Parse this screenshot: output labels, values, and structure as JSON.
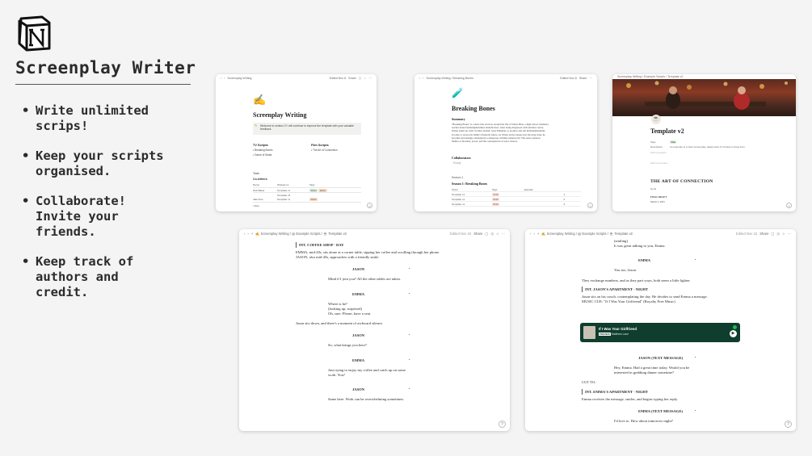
{
  "promo": {
    "title": "Screenplay Writer",
    "features": [
      [
        "Write unlimited",
        "scrips!"
      ],
      [
        "Keep your scripts",
        "organised."
      ],
      [
        "Collaborate!",
        "Invite your",
        "friends."
      ],
      [
        "Keep track of",
        "authors and",
        "credit."
      ]
    ]
  },
  "win1": {
    "crumb": "Screenplay Writing",
    "bar_right": [
      "Edited Nov 8",
      "Share"
    ],
    "title": "Screenplay Writing",
    "callout_lines": [
      "Welcome to version 2! I will continue to improve the template with your valuable",
      "feedback."
    ],
    "tv_heading": "TV Scripts",
    "tv_items": [
      "Breaking Bones",
      "Game of Seats"
    ],
    "film_heading": "Film Scripts",
    "film_items": [
      "The Art of Connection"
    ],
    "todo": "Todo",
    "cowriters": "Co-writers",
    "table_head": [
      "Name",
      "Worked on",
      "Tags"
    ],
    "rows": [
      {
        "name": "Nick Baker",
        "worked": "Template v1",
        "tag1": "Writer",
        "tag2": "Editor"
      },
      {
        "name": "",
        "worked": "Template v2",
        "tag1": "",
        "tag2": ""
      },
      {
        "name": "Jake Doe",
        "worked": "Template v1",
        "tag1": "Writer",
        "tag2": ""
      }
    ],
    "new": "New"
  },
  "win2": {
    "crumb": [
      "Screenplay Writing",
      "Breaking Bones"
    ],
    "bar_right": [
      "Edited Nov 8",
      "Share"
    ],
    "title": "Breaking Bones",
    "summary_h": "Summary",
    "summary_lines": [
      "\"Breaking Bones\" is a show that revolves around the life of Walter Blue, a high school chemistry",
      "teacher turned methamphetamine manufacturer. After being diagnosed with terminal cancer,",
      "Walter teams up with a former student, Jesse Pinkman, to produce and sell methamphetamine",
      "in order to secure his family's financial future. As Walter delves deeper into the drug trade, he",
      "becomes increasingly entangled in a dangerous criminal underworld. The series explores",
      "themes of morality, power, and the consequences of one's choices."
    ],
    "collab_h": "Collaborators",
    "collab_item": "Empty",
    "season_small": "Season 1",
    "season_h": "Season 1: Breaking Bones",
    "season_head": [
      "Script",
      "Tags",
      "Episode"
    ],
    "season_rows": [
      {
        "name": "Template v1",
        "tag": "Draft",
        "ep": "1"
      },
      {
        "name": "Template v1",
        "tag": "Draft",
        "ep": "2"
      },
      {
        "name": "Template v1",
        "tag": "Draft",
        "ep": "3"
      }
    ]
  },
  "win3": {
    "crumb": [
      "Screenplay Writing",
      "Example Scripts",
      "Template v2"
    ],
    "title": "Template v2",
    "props": [
      {
        "k": "Tags",
        "v": "Idea"
      },
      {
        "k": "Description",
        "v": "An example of a short screenplay, adapt parts of it below to draw from."
      },
      {
        "k": "Add a property",
        "v": ""
      }
    ],
    "comment": "Add a comment...",
    "heading": "THE ART OF CONNECTION",
    "by": "by AI",
    "status": "FINAL DRAFT",
    "date": "March 5, 2023"
  },
  "win4": {
    "crumb": [
      "Screenplay Writing",
      "Example Scripts",
      "Template v2"
    ],
    "edited": "Edited Nov 15",
    "share": "Share",
    "lines": [
      {
        "t": "slug",
        "text": "INT. COFFEE SHOP - DAY"
      },
      {
        "t": "action",
        "text": "EMMA, mid-20s, sits alone at a corner table, sipping her coffee and scrolling through her phone."
      },
      {
        "t": "action",
        "text": "JASON, also mid-20s, approaches with a friendly smile."
      },
      {
        "t": "cue",
        "text": "JASON"
      },
      {
        "t": "dlg",
        "text": "Mind if I join you? All the other tables are taken."
      },
      {
        "t": "cue",
        "text": "EMMA"
      },
      {
        "t": "dlg",
        "text": "Where is he?"
      },
      {
        "t": "dlg",
        "text": "(looking up, surprised)"
      },
      {
        "t": "dlg",
        "text": "Oh, sure. Please, have a seat."
      },
      {
        "t": "action",
        "text": "Jason sits down, and there's a moment of awkward silence."
      },
      {
        "t": "cue",
        "text": "JASON"
      },
      {
        "t": "dlg",
        "text": "So, what brings you here?"
      },
      {
        "t": "cue",
        "text": "EMMA"
      },
      {
        "t": "dlg",
        "text": "Just trying to enjoy my coffee and catch up on some"
      },
      {
        "t": "dlg",
        "text": "work. You?"
      },
      {
        "t": "cue",
        "text": "JASON"
      },
      {
        "t": "dlg",
        "text": "Same here. Work can be overwhelming sometimes."
      }
    ]
  },
  "win5": {
    "crumb": [
      "Screenplay Writing",
      "Example Scripts",
      "Template v2"
    ],
    "edited": "Edited Nov 15",
    "share": "Share",
    "lines_top": [
      {
        "t": "dlg",
        "text": "(smiling)"
      },
      {
        "t": "dlg",
        "text": "It was great talking to you, Emma."
      },
      {
        "t": "cue",
        "text": "EMMA"
      },
      {
        "t": "dlg",
        "text": "You too, Jason."
      },
      {
        "t": "action",
        "text": "They exchange numbers, and as they part ways, both seem a little lighter."
      },
      {
        "t": "slug",
        "text": "INT. JASON'S APARTMENT - NIGHT"
      },
      {
        "t": "action",
        "text": "Jason sits on his couch, contemplating the day. He decides to send Emma a message."
      },
      {
        "t": "action",
        "text": "MUSIC CUE: \"If I Was Your Girlfriend\" (Royalty Free Music)"
      }
    ],
    "music": {
      "song": "If I Was Your Girlfriend",
      "artist": "Matthew Lane"
    },
    "lines_bottom": [
      {
        "t": "cue",
        "text": "JASON (TEXT MESSAGE)"
      },
      {
        "t": "dlg",
        "text": "Hey, Emma. Had a great time today. Would you be"
      },
      {
        "t": "dlg",
        "text": "interested in grabbing dinner sometime?"
      },
      {
        "t": "action",
        "text": "CUT TO:"
      },
      {
        "t": "slug",
        "text": "INT. EMMA'S APARTMENT - NIGHT"
      },
      {
        "t": "action",
        "text": "Emma receives the message, smiles, and begins typing her reply."
      },
      {
        "t": "cue",
        "text": "EMMA (TEXT MESSAGE)"
      },
      {
        "t": "dlg",
        "text": "I'd love to. How about tomorrow night?"
      }
    ]
  }
}
